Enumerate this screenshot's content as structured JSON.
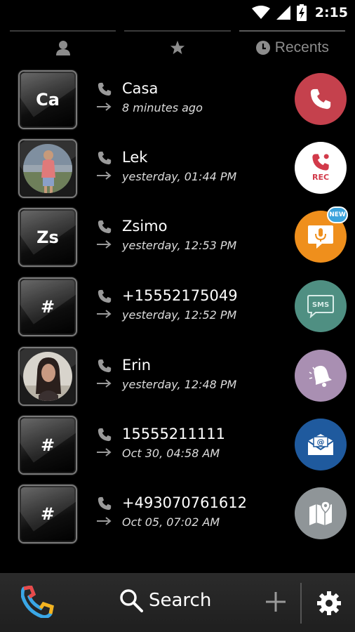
{
  "status_bar": {
    "time": "2:15",
    "icons": [
      "wifi-icon",
      "cellular-icon",
      "battery-charging-icon"
    ]
  },
  "tabs": [
    {
      "icon": "contacts-icon",
      "label": ""
    },
    {
      "icon": "star-icon",
      "label": ""
    },
    {
      "icon": "clock-icon",
      "label": "Recents",
      "active": true
    }
  ],
  "calls": [
    {
      "avatar_text": "Ca",
      "name": "Casa",
      "time": "8 minutes ago",
      "action": "call-icon",
      "action_color": "#c5414d"
    },
    {
      "avatar_text": "",
      "avatar_photo": "contact-photo-lek",
      "name": "Lek",
      "time": "yesterday, 01:44 PM",
      "action": "record-call-icon",
      "action_color": "#ffffff",
      "action_label": "REC"
    },
    {
      "avatar_text": "Zs",
      "name": "Zsimo",
      "time": "yesterday, 12:53 PM",
      "action": "voice-message-icon",
      "action_color": "#ef8f1c",
      "action_badge": "NEW"
    },
    {
      "avatar_text": "#",
      "name": "+15552175049",
      "time": "yesterday, 12:52 PM",
      "action": "sms-icon",
      "action_color": "#4f8f82"
    },
    {
      "avatar_text": "",
      "avatar_photo": "contact-photo-erin",
      "name": "Erin",
      "time": "yesterday, 12:48 PM",
      "action": "reminder-bell-icon",
      "action_color": "#a98fb2"
    },
    {
      "avatar_text": "#",
      "name": "15555211111",
      "time": "Oct 30, 04:58 AM",
      "action": "email-icon",
      "action_color": "#1f5a9e"
    },
    {
      "avatar_text": "#",
      "name": "+493070761612",
      "time": "Oct 05, 07:02 AM",
      "action": "map-icon",
      "action_color": "#8f9598"
    }
  ],
  "bottom_bar": {
    "search_label": "Search"
  },
  "colors": {
    "background": "#000000",
    "bottom_bar": "#262626",
    "tab_text": "#8c8c8c",
    "time_text": "#dcdcdc"
  }
}
